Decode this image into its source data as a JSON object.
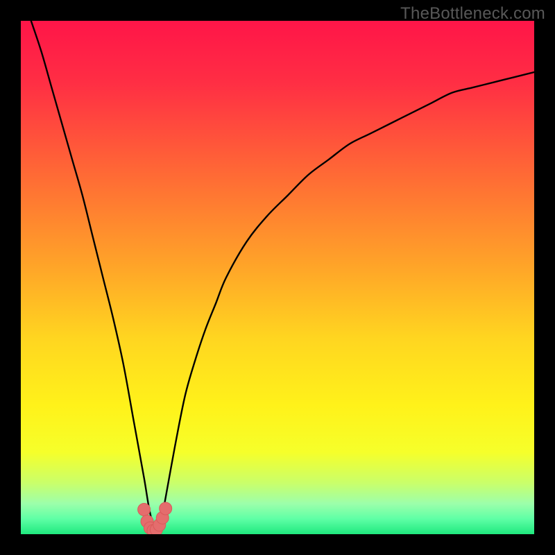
{
  "watermark": "TheBottleneck.com",
  "colors": {
    "frame": "#000000",
    "gradient_stops": [
      {
        "offset": 0.0,
        "color": "#ff1548"
      },
      {
        "offset": 0.12,
        "color": "#ff2e44"
      },
      {
        "offset": 0.3,
        "color": "#ff6a35"
      },
      {
        "offset": 0.48,
        "color": "#ffa528"
      },
      {
        "offset": 0.62,
        "color": "#ffd620"
      },
      {
        "offset": 0.75,
        "color": "#fff21a"
      },
      {
        "offset": 0.84,
        "color": "#f6ff2a"
      },
      {
        "offset": 0.9,
        "color": "#caff6a"
      },
      {
        "offset": 0.94,
        "color": "#9dffaa"
      },
      {
        "offset": 0.97,
        "color": "#5fffa6"
      },
      {
        "offset": 1.0,
        "color": "#1fe97e"
      }
    ],
    "curve": "#000000",
    "marker_fill": "#e46d6d",
    "marker_stroke": "#d95a5a"
  },
  "chart_data": {
    "type": "line",
    "title": "",
    "xlabel": "",
    "ylabel": "",
    "xlim": [
      0,
      100
    ],
    "ylim": [
      0,
      100
    ],
    "series": [
      {
        "name": "bottleneck-curve",
        "x": [
          2,
          4,
          6,
          8,
          10,
          12,
          14,
          16,
          18,
          20,
          22,
          24,
          25,
          26,
          27,
          28,
          30,
          32,
          34,
          36,
          38,
          40,
          44,
          48,
          52,
          56,
          60,
          64,
          68,
          72,
          76,
          80,
          84,
          88,
          92,
          96,
          100
        ],
        "y": [
          100,
          94,
          87,
          80,
          73,
          66,
          58,
          50,
          42,
          33,
          22,
          11,
          5,
          1,
          1,
          6,
          17,
          27,
          34,
          40,
          45,
          50,
          57,
          62,
          66,
          70,
          73,
          76,
          78,
          80,
          82,
          84,
          86,
          87,
          88,
          89,
          90
        ]
      }
    ],
    "markers": {
      "name": "highlight-points",
      "x": [
        24.0,
        24.6,
        25.2,
        25.8,
        26.4,
        27.0,
        27.6,
        28.2
      ],
      "y": [
        4.8,
        2.5,
        1.2,
        0.7,
        0.9,
        1.8,
        3.2,
        5.0
      ]
    }
  }
}
